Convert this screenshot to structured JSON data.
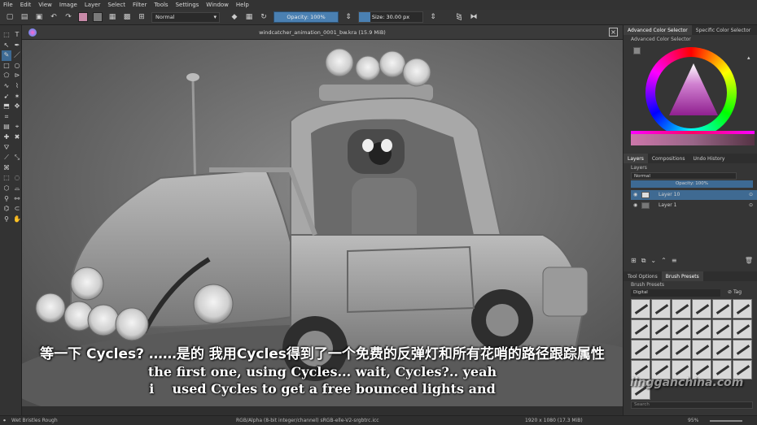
{
  "menu": [
    "File",
    "Edit",
    "View",
    "Image",
    "Layer",
    "Select",
    "Filter",
    "Tools",
    "Settings",
    "Window",
    "Help"
  ],
  "toolbar": {
    "blend_mode": "Normal",
    "opacity_label": "Opacity: 100%",
    "opacity_value": 1.0,
    "size_label": "Size: 30.00 px",
    "fg_color": "#c88aa8",
    "bg_color": "#7a7a7a"
  },
  "document": {
    "title": "windcatcher_animation_0001_bw.kra (15.9 MiB)"
  },
  "dock": {
    "color_tabs": [
      "Advanced Color Selector",
      "Specific Color Selector"
    ],
    "color_section_label": "Advanced Color Selector",
    "layer_tabs": [
      "Layers",
      "Compositions",
      "Undo History"
    ],
    "layers_label": "Layers",
    "layer_blend": "Normal",
    "layer_opacity": "Opacity: 100%",
    "layers": [
      {
        "name": "Layer 10",
        "selected": true
      },
      {
        "name": "Layer 1",
        "selected": false
      }
    ],
    "bottom_tabs": [
      "Tool Options",
      "Brush Presets"
    ],
    "brush_presets_label": "Brush Presets",
    "brush_tag": "Digital",
    "tag_label": "Tag",
    "search_placeholder": "Search"
  },
  "subtitles": {
    "line1": "等一下 Cycles? ……是的 我用Cycles得到了一个免费的反弹灯和所有花哨的路径跟踪属性",
    "line2": "the first one, using Cycles... wait, Cycles?.. yeah",
    "line3": "i    used Cycles to get a free bounced lights and"
  },
  "watermark": "lingganchina.com",
  "status": {
    "brush_name": "Wet Bristles Rough",
    "color_space": "RGB/Alpha (8-bit integer/channel)  sRGB-elle-V2-srgbtrc.icc",
    "dimensions": "1920 x 1080 (17.3 MiB)",
    "zoom": "95%"
  },
  "accent_color": "#3d6a94"
}
